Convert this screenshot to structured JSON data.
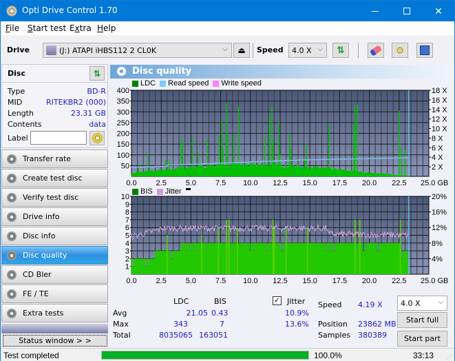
{
  "window": {
    "title": "Opti Drive Control 1.70",
    "minimize": "—",
    "maximize": "☐",
    "close": "✕"
  },
  "menu": [
    {
      "key": "F",
      "rest": "ile"
    },
    {
      "key": "S",
      "rest": "tart test"
    },
    {
      "key": "E",
      "rest": "xtra",
      "pre": ""
    },
    {
      "key": "H",
      "rest": "elp"
    }
  ],
  "menu_labels": {
    "file": "File",
    "start_test": "Start test",
    "extra": "Extra",
    "help": "Help"
  },
  "toolbar": {
    "drive_label": "Drive",
    "drive_value": "(J:)  ATAPI iHBS112  2 CL0K",
    "speed_label": "Speed",
    "speed_value": "4.0 X"
  },
  "disc": {
    "header": "Disc",
    "rows": [
      {
        "key": "Type",
        "value": "BD-R"
      },
      {
        "key": "MID",
        "value": "RITEKBR2 (000)"
      },
      {
        "key": "Length",
        "value": "23.31 GB"
      },
      {
        "key": "Contents",
        "value": "data"
      }
    ],
    "label_key": "Label",
    "label_value": ""
  },
  "nav": [
    {
      "label": "Transfer rate",
      "active": false
    },
    {
      "label": "Create test disc",
      "active": false
    },
    {
      "label": "Verify test disc",
      "active": false
    },
    {
      "label": "Drive info",
      "active": false
    },
    {
      "label": "Disc info",
      "active": false
    },
    {
      "label": "Disc quality",
      "active": true
    },
    {
      "label": "CD Bler",
      "active": false
    },
    {
      "label": "FE / TE",
      "active": false
    },
    {
      "label": "Extra tests",
      "active": false
    }
  ],
  "status_window_btn": "Status window > >",
  "panel_title": "Disc quality",
  "chart_data": [
    {
      "type": "bar",
      "title": "LDC / Read speed",
      "legend": [
        "LDC",
        "Read speed",
        "Write speed"
      ],
      "legend_colors": [
        "#008000",
        "#80c8ff",
        "#ff80ff"
      ],
      "legend_position": "top-left",
      "xlabel": "GB",
      "x_ticks": [
        "0.0",
        "2.5",
        "5.0",
        "7.5",
        "10.0",
        "12.5",
        "15.0",
        "17.5",
        "20.0",
        "22.5",
        "25.0 GB"
      ],
      "xlim": [
        0,
        25
      ],
      "y_left_ticks": [
        "50",
        "100",
        "150",
        "200",
        "250",
        "300",
        "350",
        "400"
      ],
      "ylim_left": [
        0,
        400
      ],
      "y_right_ticks": [
        "2 X",
        "4 X",
        "6 X",
        "8 X",
        "10 X",
        "12 X",
        "14 X",
        "16 X",
        "18 X"
      ],
      "ylim_right": [
        0,
        18
      ],
      "grid": true,
      "ldc_spikes": [
        [
          0.6,
          55
        ],
        [
          1.4,
          105
        ],
        [
          2.9,
          75
        ],
        [
          3.2,
          80
        ],
        [
          4.2,
          175
        ],
        [
          4.3,
          160
        ],
        [
          5.1,
          185
        ],
        [
          5.6,
          110
        ],
        [
          6.4,
          170
        ],
        [
          7.4,
          185
        ],
        [
          7.6,
          265
        ],
        [
          7.7,
          130
        ],
        [
          8.0,
          340
        ],
        [
          8.1,
          200
        ],
        [
          8.6,
          190
        ],
        [
          9.0,
          325
        ],
        [
          11.2,
          185
        ],
        [
          11.6,
          275
        ],
        [
          11.8,
          325
        ],
        [
          11.9,
          170
        ],
        [
          12.4,
          255
        ],
        [
          12.5,
          100
        ],
        [
          13.3,
          200
        ],
        [
          13.4,
          130
        ],
        [
          14.6,
          75
        ],
        [
          14.7,
          155
        ],
        [
          16.6,
          240
        ],
        [
          18.7,
          240
        ],
        [
          18.8,
          325
        ],
        [
          19.0,
          335
        ],
        [
          22.5,
          305
        ],
        [
          22.7,
          140
        ],
        [
          23.0,
          120
        ]
      ],
      "ldc_baseline": {
        "start": 15,
        "peak": 60,
        "end": 20
      },
      "read_speed_x": [
        0,
        1,
        2,
        3,
        4,
        5,
        6,
        7,
        8,
        9,
        10,
        11,
        12,
        13,
        14,
        15,
        16,
        17,
        18,
        19,
        20,
        21,
        22,
        23,
        23.31
      ],
      "read_speed_y": [
        1.9,
        2.0,
        2.1,
        2.35,
        2.45,
        2.55,
        2.65,
        2.75,
        2.85,
        2.95,
        3.05,
        3.15,
        3.25,
        3.35,
        3.45,
        3.5,
        3.55,
        3.6,
        3.65,
        3.7,
        3.75,
        3.8,
        3.85,
        3.9,
        4.0
      ],
      "end_marker_gb": 23.31
    },
    {
      "type": "bar",
      "title": "BIS / Jitter",
      "legend": [
        "BIS",
        "Jitter"
      ],
      "legend_colors": [
        "#008000",
        "#d0a0d8"
      ],
      "legend_position": "top-left",
      "xlabel": "GB",
      "x_ticks": [
        "0.0",
        "2.5",
        "5.0",
        "7.5",
        "10.0",
        "12.5",
        "15.0",
        "17.5",
        "20.0",
        "22.5",
        "25.0 GB"
      ],
      "xlim": [
        0,
        25
      ],
      "y_left_ticks": [
        "1",
        "2",
        "3",
        "4",
        "5",
        "6",
        "7",
        "8",
        "9",
        "10"
      ],
      "ylim_left": [
        0,
        10
      ],
      "y_right_ticks": [
        "4%",
        "8%",
        "12%",
        "16%",
        "20%"
      ],
      "ylim_right": [
        0,
        20
      ],
      "grid": true,
      "bis_levels": [
        [
          0,
          2
        ],
        [
          2.0,
          3
        ],
        [
          4.2,
          4
        ],
        [
          16.5,
          4
        ],
        [
          22.7,
          3
        ],
        [
          23.2,
          2
        ]
      ],
      "bis_spikes": [
        [
          3.0,
          5
        ],
        [
          5.9,
          5
        ],
        [
          7.3,
          6
        ],
        [
          8.0,
          7
        ],
        [
          8.2,
          7
        ],
        [
          8.9,
          6
        ],
        [
          11.9,
          7
        ],
        [
          12.0,
          6
        ],
        [
          13.0,
          6
        ],
        [
          14.8,
          6
        ],
        [
          18.8,
          7
        ],
        [
          19.2,
          7
        ],
        [
          22.6,
          7
        ]
      ],
      "jitter_pct": {
        "start": 9.6,
        "mid": 11.8,
        "after_16_5": 10.3,
        "end": 10.0
      },
      "end_marker_gb": 23.31
    }
  ],
  "stats": {
    "col_ldc": "LDC",
    "col_bis": "BIS",
    "jitter_label": "Jitter",
    "jitter_checked": true,
    "avg_label": "Avg",
    "max_label": "Max",
    "total_label": "Total",
    "avg_ldc": "21.05",
    "avg_bis": "0.43",
    "avg_jitter": "10.9%",
    "max_ldc": "343",
    "max_bis": "7",
    "max_jitter": "13.6%",
    "total_ldc": "8035065",
    "total_bis": "163051",
    "speed_label": "Speed",
    "speed_value": "4.19 X",
    "position_label": "Position",
    "position_value": "23862 MB",
    "samples_label": "Samples",
    "samples_value": "380389",
    "speed_select": "4.0 X",
    "start_full": "Start full",
    "start_part": "Start part"
  },
  "statusbar": {
    "text": "Test completed",
    "progress": 100.0,
    "progress_text": "100.0%",
    "time": "33:13"
  }
}
